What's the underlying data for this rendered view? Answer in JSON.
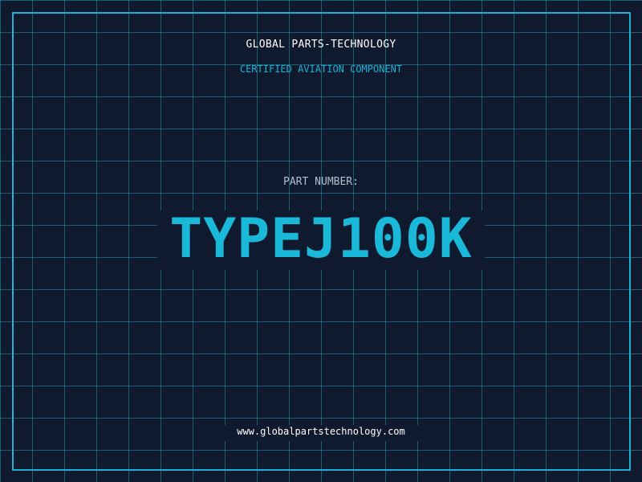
{
  "header": {
    "company": "GLOBAL PARTS-TECHNOLOGY",
    "certification": "CERTIFIED AVIATION COMPONENT"
  },
  "part": {
    "label": "PART NUMBER:",
    "number": "TYPEJ100K"
  },
  "footer": {
    "website": "www.globalpartstechnology.com"
  },
  "colors": {
    "background": "#0f1a2e",
    "accent": "#1fb1d4",
    "grid": "#2896aa"
  }
}
